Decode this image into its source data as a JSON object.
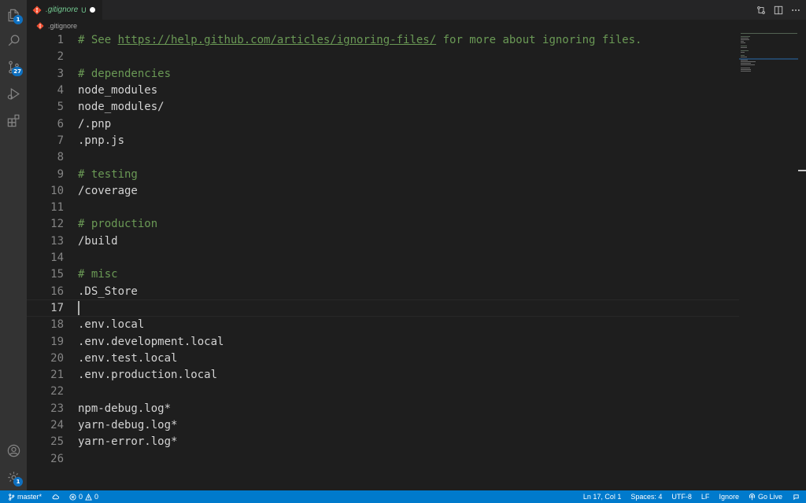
{
  "activity_bar": {
    "explorer_badge": "1",
    "source_control_badge": "27",
    "settings_badge": "1"
  },
  "tab": {
    "file_name": ".gitignore",
    "git_status": "U"
  },
  "breadcrumb": {
    "file_name": ".gitignore"
  },
  "editor": {
    "active_line": 17,
    "lines": [
      {
        "n": "1",
        "pre": "# See ",
        "url": "https://help.github.com/articles/ignoring-files/",
        "post": " for more about ignoring files.",
        "type": "comment"
      },
      {
        "n": "2",
        "text": "",
        "type": "plain"
      },
      {
        "n": "3",
        "text": "# dependencies",
        "type": "comment"
      },
      {
        "n": "4",
        "text": "node_modules",
        "type": "plain"
      },
      {
        "n": "5",
        "text": "node_modules/",
        "type": "plain"
      },
      {
        "n": "6",
        "text": "/.pnp",
        "type": "plain"
      },
      {
        "n": "7",
        "text": ".pnp.js",
        "type": "plain"
      },
      {
        "n": "8",
        "text": "",
        "type": "plain"
      },
      {
        "n": "9",
        "text": "# testing",
        "type": "comment"
      },
      {
        "n": "10",
        "text": "/coverage",
        "type": "plain"
      },
      {
        "n": "11",
        "text": "",
        "type": "plain"
      },
      {
        "n": "12",
        "text": "# production",
        "type": "comment"
      },
      {
        "n": "13",
        "text": "/build",
        "type": "plain"
      },
      {
        "n": "14",
        "text": "",
        "type": "plain"
      },
      {
        "n": "15",
        "text": "# misc",
        "type": "comment"
      },
      {
        "n": "16",
        "text": ".DS_Store",
        "type": "plain"
      },
      {
        "n": "17",
        "text": "",
        "type": "plain"
      },
      {
        "n": "18",
        "text": ".env.local",
        "type": "plain"
      },
      {
        "n": "19",
        "text": ".env.development.local",
        "type": "plain"
      },
      {
        "n": "20",
        "text": ".env.test.local",
        "type": "plain"
      },
      {
        "n": "21",
        "text": ".env.production.local",
        "type": "plain"
      },
      {
        "n": "22",
        "text": "",
        "type": "plain"
      },
      {
        "n": "23",
        "text": "npm-debug.log*",
        "type": "plain"
      },
      {
        "n": "24",
        "text": "yarn-debug.log*",
        "type": "plain"
      },
      {
        "n": "25",
        "text": "yarn-error.log*",
        "type": "plain"
      },
      {
        "n": "26",
        "text": "",
        "type": "plain"
      }
    ]
  },
  "status_bar": {
    "branch": "master*",
    "errors": "0",
    "warnings": "0",
    "position": "Ln 17, Col 1",
    "indent": "Spaces: 4",
    "encoding": "UTF-8",
    "eol": "LF",
    "language": "Ignore",
    "go_live": "Go Live"
  },
  "colors": {
    "status_bar_bg": "#007acc",
    "comment": "#6a9955",
    "untracked": "#73c991",
    "badge": "#0e70c0"
  }
}
